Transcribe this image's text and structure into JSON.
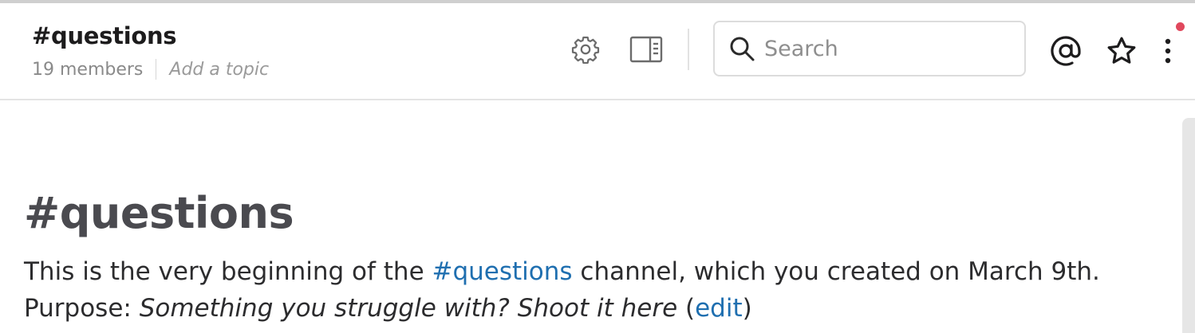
{
  "header": {
    "channel_name": "#questions",
    "members": "19 members",
    "add_topic": "Add a topic"
  },
  "toolbar": {
    "settings_icon": "gear-icon",
    "details_icon": "panel-icon",
    "search_placeholder": "Search",
    "mentions_icon": "at-icon",
    "starred_icon": "star-icon",
    "more_icon": "more-vertical-icon",
    "notification_color": "#e0485d"
  },
  "intro": {
    "title": "#questions",
    "line1_prefix": "This is the very beginning of the ",
    "line1_channel": "#questions",
    "line1_suffix": " channel, which you created on March 9th.",
    "purpose_label": "Purpose: ",
    "purpose_text": "Something you struggle with? Shoot it here",
    "paren_open": " (",
    "edit_label": "edit",
    "paren_close": ")"
  },
  "colors": {
    "link": "#1f6fb0",
    "muted": "#8a8a8a"
  }
}
